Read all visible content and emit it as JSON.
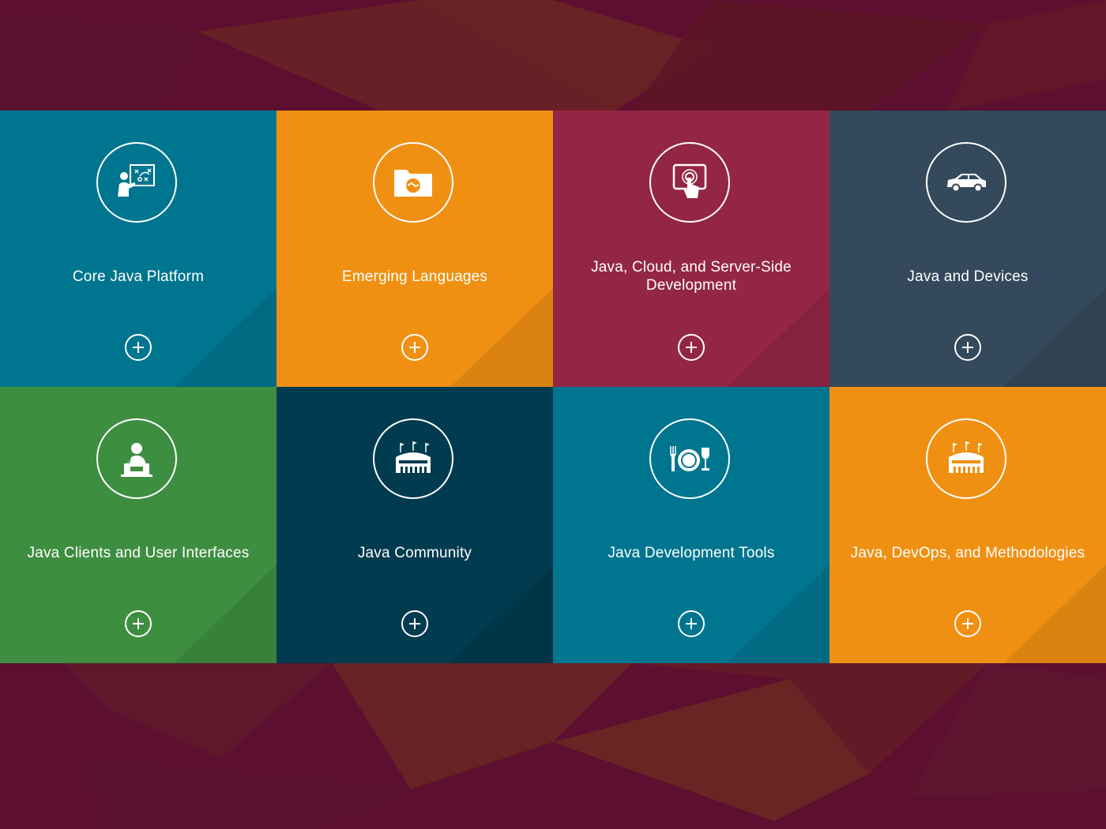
{
  "colors": {
    "background": "#5c0f2f",
    "background_accent": "#7a3a1c",
    "teal": "#00758f",
    "orange": "#f09012",
    "crimson": "#942645",
    "slate": "#34495b",
    "green": "#3e8e41",
    "navy": "#003b4f"
  },
  "tiles": [
    {
      "title": "Core Java Platform",
      "icon": "teacher-whiteboard-icon",
      "color": "#00758f"
    },
    {
      "title": "Emerging Languages",
      "icon": "folder-handshake-icon",
      "color": "#f09012"
    },
    {
      "title": "Java, Cloud, and Server-Side Development",
      "icon": "tablet-touch-icon",
      "color": "#942645"
    },
    {
      "title": "Java and Devices",
      "icon": "car-icon",
      "color": "#34495b"
    },
    {
      "title": "Java Clients and User Interfaces",
      "icon": "speaker-podium-icon",
      "color": "#3e8e41"
    },
    {
      "title": "Java Community",
      "icon": "stadium-icon",
      "color": "#003b4f"
    },
    {
      "title": "Java Development Tools",
      "icon": "dining-plate-icon",
      "color": "#00758f"
    },
    {
      "title": "Java, DevOps, and Methodologies",
      "icon": "stadium-icon",
      "color": "#f09012"
    }
  ]
}
